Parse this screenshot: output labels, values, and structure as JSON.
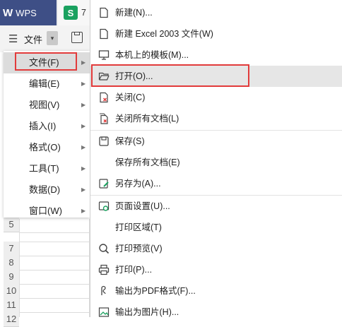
{
  "tabs": {
    "wps_logo": "W",
    "wps_label": "WPS",
    "doc_icon": "S",
    "doc_label": "7"
  },
  "toolbar": {
    "menu_icon": "hamburger-icon",
    "file_label": "文件",
    "dropdown": "chevron-down-icon"
  },
  "row_headers": [
    "5",
    "7",
    "8",
    "9",
    "10",
    "11",
    "12"
  ],
  "submenu": {
    "items": [
      {
        "label": "文件(F)",
        "active": true
      },
      {
        "label": "编辑(E)",
        "active": false
      },
      {
        "label": "视图(V)",
        "active": false
      },
      {
        "label": "插入(I)",
        "active": false
      },
      {
        "label": "格式(O)",
        "active": false
      },
      {
        "label": "工具(T)",
        "active": false
      },
      {
        "label": "数据(D)",
        "active": false
      },
      {
        "label": "窗口(W)",
        "active": false
      }
    ]
  },
  "file_menu": {
    "items": [
      {
        "label": "新建(N)...",
        "icon": "new-document-icon"
      },
      {
        "label": "新建 Excel 2003 文件(W)",
        "icon": "new-document-icon"
      },
      {
        "label": "本机上的模板(M)...",
        "icon": "template-icon"
      },
      {
        "label": "打开(O)...",
        "icon": "folder-open-icon",
        "active": true
      },
      {
        "label": "关闭(C)",
        "icon": "close-document-icon"
      },
      {
        "label": "关闭所有文档(L)",
        "icon": "close-all-icon"
      },
      {
        "label": "保存(S)",
        "icon": "save-icon"
      },
      {
        "label": "保存所有文档(E)",
        "icon": ""
      },
      {
        "label": "另存为(A)...",
        "icon": "save-as-icon"
      },
      {
        "label": "页面设置(U)...",
        "icon": "page-setup-icon"
      },
      {
        "label": "打印区域(T)",
        "icon": ""
      },
      {
        "label": "打印预览(V)",
        "icon": "print-preview-icon"
      },
      {
        "label": "打印(P)...",
        "icon": "printer-icon"
      },
      {
        "label": "输出为PDF格式(F)...",
        "icon": "export-pdf-icon"
      },
      {
        "label": "输出为图片(H)...",
        "icon": "export-image-icon"
      }
    ]
  },
  "colors": {
    "wps_tab": "#3e4f86",
    "doc_icon": "#1aa15f",
    "highlight": "#e23b3b"
  }
}
